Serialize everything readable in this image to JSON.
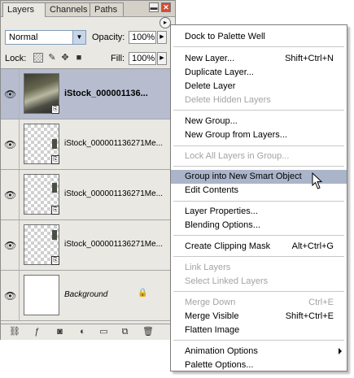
{
  "palette": {
    "tabs": [
      "Layers",
      "Channels",
      "Paths"
    ],
    "close_glyph": "✕",
    "minimize_glyph": "▬",
    "menu_glyph": "▸",
    "blend_mode": "Normal",
    "opacity_label": "Opacity:",
    "opacity_value": "100%",
    "lock_label": "Lock:",
    "fill_label": "Fill:",
    "fill_value": "100%",
    "layers": [
      {
        "name": "iStock_000001136...",
        "selected": true,
        "thumbnail": "photo"
      },
      {
        "name": "iStock_000001136271Me...",
        "selected": false,
        "thumbnail": "transparent"
      },
      {
        "name": "iStock_000001136271Me...",
        "selected": false,
        "thumbnail": "transparent"
      },
      {
        "name": "iStock_000001136271Me...",
        "selected": false,
        "thumbnail": "transparent"
      },
      {
        "name": "Background",
        "selected": false,
        "thumbnail": "white",
        "locked": true
      }
    ],
    "bottom_icons": [
      "link-layers-icon",
      "layer-style-icon",
      "layer-mask-icon",
      "adjustment-layer-icon",
      "new-group-icon",
      "new-layer-icon",
      "trash-icon"
    ]
  },
  "menu": {
    "items": [
      {
        "label": "Dock to Palette Well",
        "shortcut": "",
        "enabled": true
      },
      {
        "label": "New Layer...",
        "shortcut": "Shift+Ctrl+N",
        "enabled": true
      },
      {
        "label": "Duplicate Layer...",
        "shortcut": "",
        "enabled": true
      },
      {
        "label": "Delete Layer",
        "shortcut": "",
        "enabled": true
      },
      {
        "label": "Delete Hidden Layers",
        "shortcut": "",
        "enabled": false
      },
      {
        "label": "New Group...",
        "shortcut": "",
        "enabled": true
      },
      {
        "label": "New Group from Layers...",
        "shortcut": "",
        "enabled": true
      },
      {
        "label": "Lock All Layers in Group...",
        "shortcut": "",
        "enabled": false
      },
      {
        "label": "Group into New Smart Object",
        "shortcut": "",
        "enabled": true,
        "highlighted": true
      },
      {
        "label": "Edit Contents",
        "shortcut": "",
        "enabled": true
      },
      {
        "label": "Layer Properties...",
        "shortcut": "",
        "enabled": true
      },
      {
        "label": "Blending Options...",
        "shortcut": "",
        "enabled": true
      },
      {
        "label": "Create Clipping Mask",
        "shortcut": "Alt+Ctrl+G",
        "enabled": true
      },
      {
        "label": "Link Layers",
        "shortcut": "",
        "enabled": false
      },
      {
        "label": "Select Linked Layers",
        "shortcut": "",
        "enabled": false
      },
      {
        "label": "Merge Down",
        "shortcut": "Ctrl+E",
        "enabled": false
      },
      {
        "label": "Merge Visible",
        "shortcut": "Shift+Ctrl+E",
        "enabled": true
      },
      {
        "label": "Flatten Image",
        "shortcut": "",
        "enabled": true
      },
      {
        "label": "Animation Options",
        "shortcut": "",
        "enabled": true,
        "submenu": true
      },
      {
        "label": "Palette Options...",
        "shortcut": "",
        "enabled": true
      }
    ],
    "highlight_color": "#aab5ca"
  }
}
